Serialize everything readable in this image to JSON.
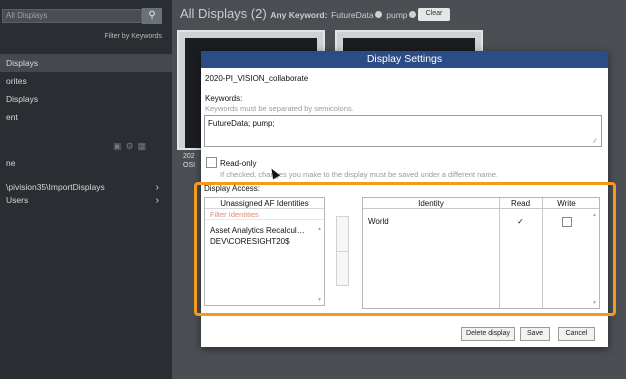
{
  "sidebar": {
    "search_placeholder": "All Displays",
    "search_icon": "search-icon",
    "filter_link": "Filter by Keywords",
    "nav_items": [
      {
        "label": "Displays",
        "active": true
      },
      {
        "label": "orites",
        "active": false
      },
      {
        "label": "Displays",
        "active": false
      },
      {
        "label": "ent",
        "active": false
      }
    ],
    "tree_items": [
      {
        "label": "ne",
        "chevron": false
      },
      {
        "label": "\\pivision35\\ImportDisplays",
        "chevron": true
      },
      {
        "label": "Users",
        "chevron": true
      }
    ]
  },
  "main": {
    "heading": "All Displays (2)",
    "keyword_prefix": "Any Keyword:",
    "keyword_tag1": "FutureData",
    "keyword_tag2": "pump",
    "clear_label": "Clear",
    "thumb_label_line1": "202",
    "thumb_label_line2": "OSI"
  },
  "dialog": {
    "title": "Display Settings",
    "display_name": "2020-PI_VISION_collaborate",
    "keywords_label": "Keywords:",
    "keywords_hint": "Keywords must be separated by semicolons.",
    "keywords_value": "FutureData; pump;",
    "readonly_label": "Read-only",
    "readonly_hint": "If checked, changes you make to the display must be saved under a different name.",
    "access_label": "Display Access:",
    "unassigned_header": "Unassigned AF Identities",
    "unassigned_filter": "Filter Identities",
    "unassigned_items": [
      "Asset Analytics Recalcul…",
      "DEV\\CORESIGHT20$"
    ],
    "table_headers": {
      "identity": "Identity",
      "read": "Read",
      "write": "Write"
    },
    "rows": [
      {
        "identity": "World",
        "read": "✓",
        "write_checked": false
      }
    ],
    "buttons": {
      "delete": "Delete display",
      "save": "Save",
      "cancel": "Cancel"
    }
  },
  "colors": {
    "title_bar": "#2b4c85",
    "highlight": "#f59b1c",
    "filter_text": "#e08a7a"
  }
}
